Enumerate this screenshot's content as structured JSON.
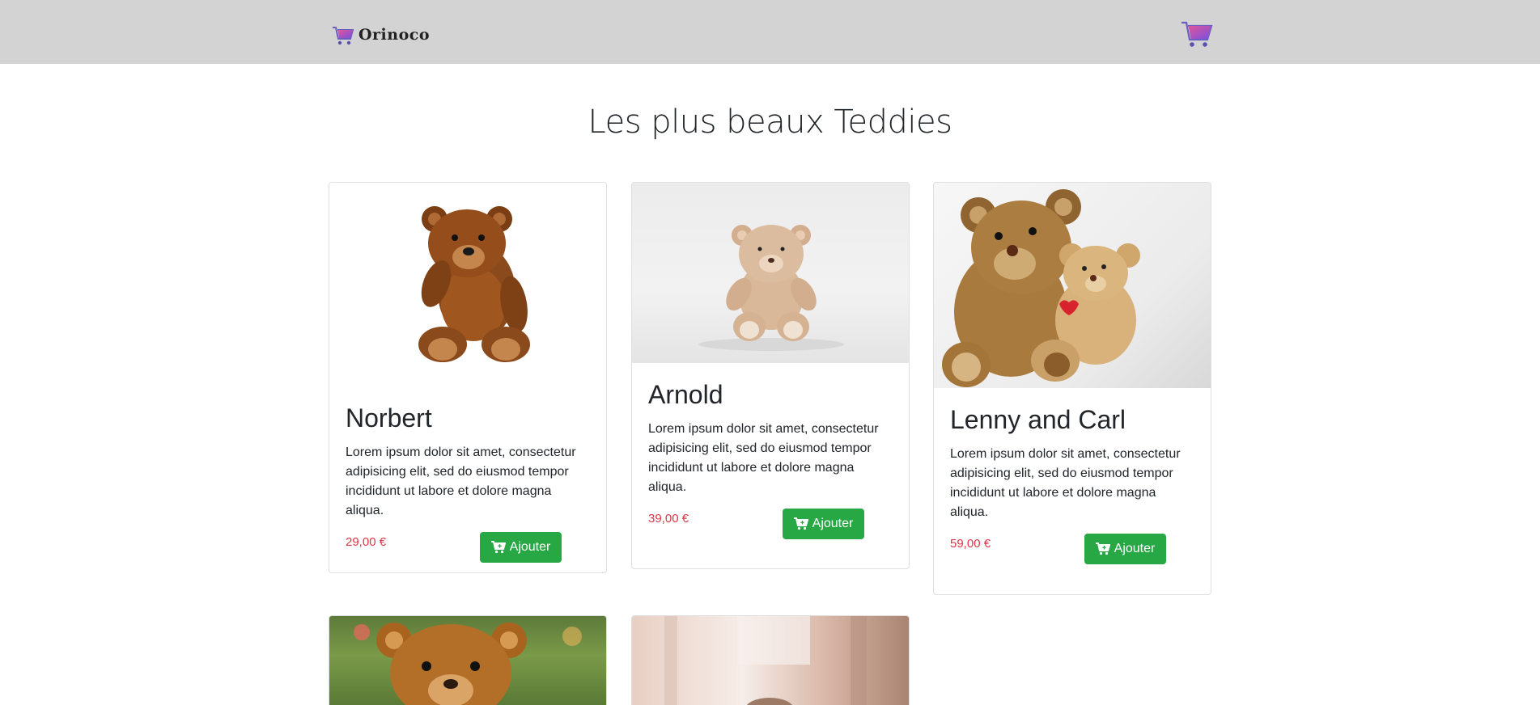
{
  "navbar": {
    "brand_name": "Orinoco",
    "brand_icon": "shopping-cart-gradient-icon",
    "cart_icon": "shopping-cart-gradient-icon"
  },
  "page": {
    "title": "Les plus beaux Teddies"
  },
  "products": [
    {
      "name": "Norbert",
      "description": "Lorem ipsum dolor sit amet, consectetur adipisicing elit, sed do eiusmod tempor incididunt ut labore et dolore magna aliqua.",
      "price": "29,00 €",
      "button_label": "Ajouter"
    },
    {
      "name": "Arnold",
      "description": "Lorem ipsum dolor sit amet, consectetur adipisicing elit, sed do eiusmod tempor incididunt ut labore et dolore magna aliqua.",
      "price": "39,00 €",
      "button_label": "Ajouter"
    },
    {
      "name": "Lenny and Carl",
      "description": "Lorem ipsum dolor sit amet, consectetur adipisicing elit, sed do eiusmod tempor incididunt ut labore et dolore magna aliqua.",
      "price": "59,00 €",
      "button_label": "Ajouter"
    }
  ],
  "colors": {
    "navbar_bg": "#d3d3d3",
    "price": "#dc3545",
    "button": "#28a745"
  }
}
